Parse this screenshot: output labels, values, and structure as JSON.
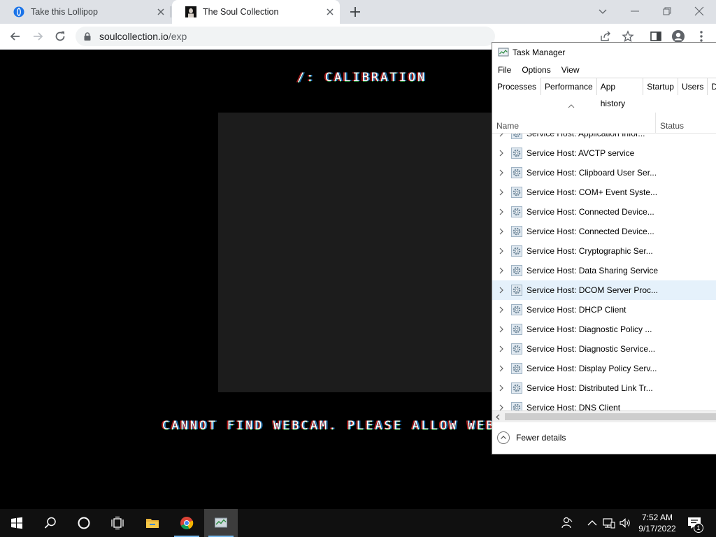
{
  "browser": {
    "tabs": [
      {
        "title": "Take this Lollipop",
        "active": false,
        "favicon": "lollipop-globe-icon"
      },
      {
        "title": "The Soul Collection",
        "active": true,
        "favicon": "soul-collection-portrait-icon"
      }
    ],
    "url_host": "soulcollection.io",
    "url_path": "/exp"
  },
  "page": {
    "title": "/: CALIBRATION",
    "message": "CANNOT FIND WEBCAM. PLEASE ALLOW WEBCAM"
  },
  "task_manager": {
    "title": "Task Manager",
    "menu": [
      "File",
      "Options",
      "View"
    ],
    "tabs": [
      "Processes",
      "Performance",
      "App history",
      "Startup",
      "Users",
      "D"
    ],
    "active_tab": "Processes",
    "columns": {
      "name": "Name",
      "status": "Status"
    },
    "processes": [
      "Service Host: Application Infor...",
      "Service Host: AVCTP service",
      "Service Host: Clipboard User Ser...",
      "Service Host: COM+ Event Syste...",
      "Service Host: Connected Device...",
      "Service Host: Connected Device...",
      "Service Host: Cryptographic Ser...",
      "Service Host: Data Sharing Service",
      "Service Host: DCOM Server Proc...",
      "Service Host: DHCP Client",
      "Service Host: Diagnostic Policy ...",
      "Service Host: Diagnostic Service...",
      "Service Host: Display Policy Serv...",
      "Service Host: Distributed Link Tr...",
      "Service Host: DNS Client"
    ],
    "highlighted_process_index": 8,
    "fewer_details": "Fewer details"
  },
  "taskbar": {
    "time": "7:52 AM",
    "date": "9/17/2022",
    "notification_count": "1",
    "accent_color": "#76b9ed"
  }
}
